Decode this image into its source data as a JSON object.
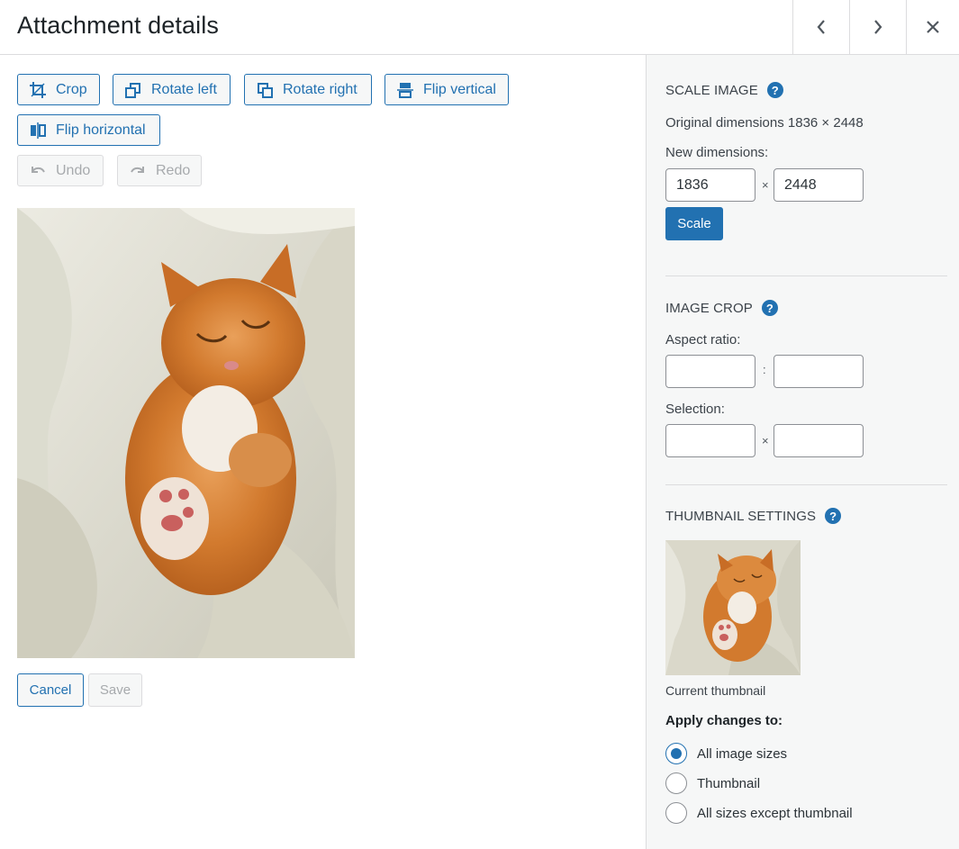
{
  "header": {
    "title": "Attachment details",
    "prev_icon": "chevron-left-icon",
    "next_icon": "chevron-right-icon",
    "close_icon": "close-icon"
  },
  "toolbar": {
    "crop": "Crop",
    "rotate_left": "Rotate left",
    "rotate_right": "Rotate right",
    "flip_vertical": "Flip vertical",
    "flip_horizontal": "Flip horizontal",
    "undo": "Undo",
    "redo": "Redo"
  },
  "actions": {
    "cancel": "Cancel",
    "save": "Save"
  },
  "scale_image": {
    "title": "Scale Image",
    "original_dimensions": "Original dimensions 1836 × 2448",
    "new_dimensions_label": "New dimensions:",
    "width": "1836",
    "height": "2448",
    "separator": "×",
    "scale_button": "Scale"
  },
  "image_crop": {
    "title": "Image Crop",
    "aspect_ratio_label": "Aspect ratio:",
    "aspect_separator": ":",
    "aspect_w": "",
    "aspect_h": "",
    "selection_label": "Selection:",
    "selection_separator": "×",
    "selection_w": "",
    "selection_h": ""
  },
  "thumbnail_settings": {
    "title": "Thumbnail Settings",
    "current_thumbnail": "Current thumbnail",
    "apply_changes_to": "Apply changes to:",
    "options": [
      {
        "label": "All image sizes",
        "checked": true
      },
      {
        "label": "Thumbnail",
        "checked": false
      },
      {
        "label": "All sizes except thumbnail",
        "checked": false
      }
    ]
  },
  "colors": {
    "accent": "#2271b1",
    "sidebar_bg": "#f6f7f7",
    "border": "#dcdcde"
  }
}
